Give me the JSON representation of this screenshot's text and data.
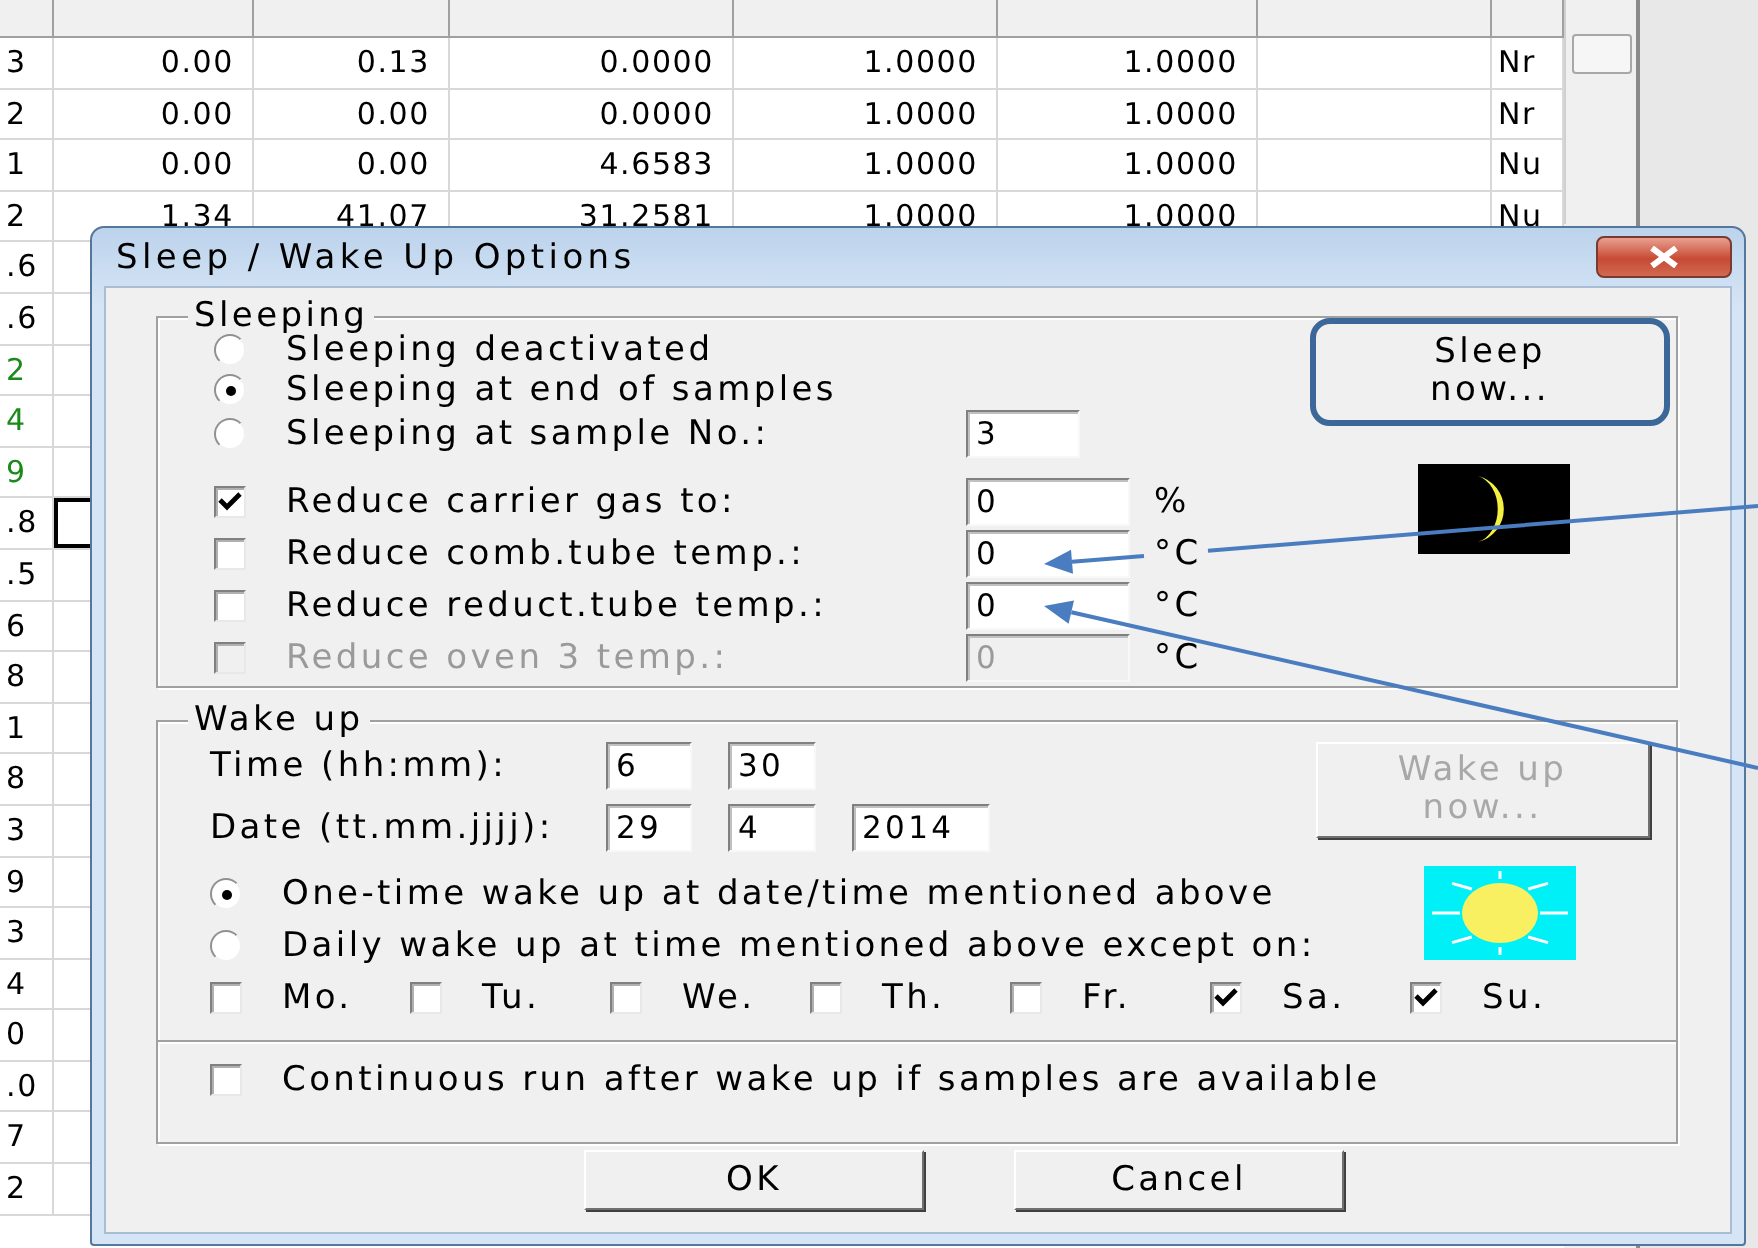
{
  "background_table": {
    "rows": [
      {
        "column_1": "3",
        "column_2": "0.00",
        "column_3": "0.13",
        "column_4": "0.0000",
        "column_5": "1.0000",
        "column_6": "1.0000",
        "column_8": "Nr",
        "color": "#000000",
        "cursor": false
      },
      {
        "column_1": "2",
        "column_2": "0.00",
        "column_3": "0.00",
        "column_4": "0.0000",
        "column_5": "1.0000",
        "column_6": "1.0000",
        "column_8": "Nr",
        "color": "#000000",
        "cursor": false
      },
      {
        "column_1": "1",
        "column_2": "0.00",
        "column_3": "0.00",
        "column_4": "4.6583",
        "column_5": "1.0000",
        "column_6": "1.0000",
        "column_8": "Nu",
        "color": "#000000",
        "cursor": false
      },
      {
        "column_1": "2",
        "column_2": "1.34",
        "column_3": "41.07",
        "column_4": "31.2581",
        "column_5": "1.0000",
        "column_6": "1.0000",
        "column_8": "Nu",
        "color": "#000000",
        "cursor": false
      },
      {
        "column_1": ".6",
        "color": "#000000",
        "cursor": false
      },
      {
        "column_1": ".6",
        "color": "#000000",
        "cursor": false
      },
      {
        "column_1": "2",
        "color": "#1a8a1a",
        "cursor": false
      },
      {
        "column_1": "4",
        "color": "#1a8a1a",
        "cursor": false
      },
      {
        "column_1": "9",
        "color": "#1a8a1a",
        "cursor": false
      },
      {
        "column_1": ".8",
        "color": "#000000",
        "cursor": true
      },
      {
        "column_1": ".5",
        "color": "#000000",
        "cursor": false
      },
      {
        "column_1": "6",
        "color": "#000000",
        "cursor": false
      },
      {
        "column_1": "8",
        "color": "#000000",
        "cursor": false
      },
      {
        "column_1": "1",
        "color": "#000000",
        "cursor": false
      },
      {
        "column_1": "8",
        "color": "#000000",
        "cursor": false
      },
      {
        "column_1": "3",
        "color": "#000000",
        "cursor": false
      },
      {
        "column_1": "9",
        "color": "#000000",
        "cursor": false
      },
      {
        "column_1": "3",
        "color": "#000000",
        "cursor": false
      },
      {
        "column_1": "4",
        "color": "#000000",
        "cursor": false
      },
      {
        "column_1": "0",
        "color": "#000000",
        "cursor": false
      },
      {
        "column_1": ".0",
        "color": "#000000",
        "cursor": false
      },
      {
        "column_1": "7",
        "color": "#000000",
        "cursor": false
      },
      {
        "column_1": "2",
        "color": "#000000",
        "cursor": false
      }
    ]
  },
  "dialog": {
    "title": "Sleep / Wake Up Options",
    "sleeping": {
      "legend": "Sleeping",
      "modes": [
        {
          "label": "Sleeping deactivated",
          "selected": false
        },
        {
          "label": "Sleeping at end of samples",
          "selected": true
        },
        {
          "label": "Sleeping at sample No.:",
          "selected": false,
          "value": "3"
        }
      ],
      "reductions": [
        {
          "label": "Reduce carrier gas to:",
          "checked": true,
          "disabled": false,
          "value": "0",
          "unit": "%"
        },
        {
          "label": "Reduce comb.tube temp.:",
          "checked": false,
          "disabled": false,
          "value": "0",
          "unit": "°C"
        },
        {
          "label": "Reduce reduct.tube temp.:",
          "checked": false,
          "disabled": false,
          "value": "0",
          "unit": "°C"
        },
        {
          "label": "Reduce oven 3 temp.:",
          "checked": false,
          "disabled": true,
          "value": "0",
          "unit": "°C"
        }
      ],
      "sleep_button": {
        "label": "Sleep now...",
        "focused": true,
        "disabled": false
      }
    },
    "wake_up": {
      "legend": "Wake up",
      "time": {
        "label": "Time (hh:mm):",
        "values": [
          "6",
          "30"
        ]
      },
      "date": {
        "label": "Date (tt.mm.jjjj):",
        "values": [
          "29",
          "4",
          "2014"
        ]
      },
      "modes": [
        {
          "label": "One-time wake up at date/time mentioned above",
          "selected": true
        },
        {
          "label": "Daily wake up at time mentioned above except on:",
          "selected": false
        }
      ],
      "days": [
        {
          "label": "Mo.",
          "checked": false
        },
        {
          "label": "Tu.",
          "checked": false
        },
        {
          "label": "We.",
          "checked": false
        },
        {
          "label": "Th.",
          "checked": false
        },
        {
          "label": "Fr.",
          "checked": false
        },
        {
          "label": "Sa.",
          "checked": true
        },
        {
          "label": "Su.",
          "checked": true
        }
      ],
      "wake_button": {
        "label": "Wake up now...",
        "focused": false,
        "disabled": true
      },
      "continuous": {
        "label": "Continuous run after wake up if samples are available",
        "checked": false
      }
    },
    "buttons": [
      "OK",
      "Cancel"
    ]
  }
}
